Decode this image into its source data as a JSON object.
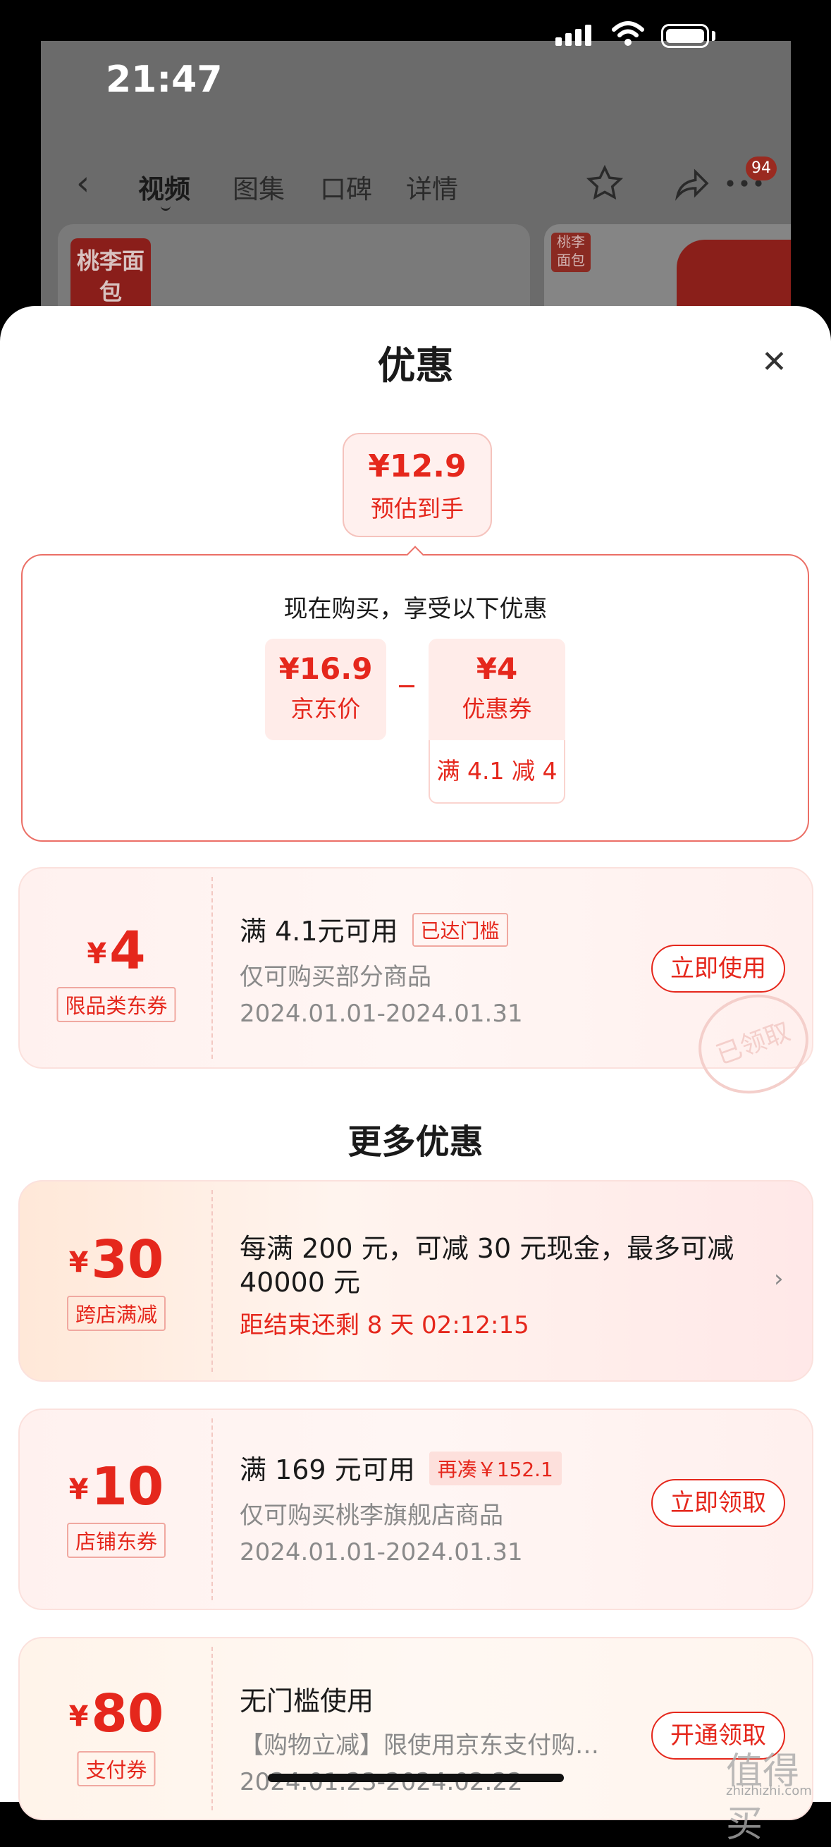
{
  "status_bar": {
    "time": "21:47"
  },
  "nav": {
    "tabs": [
      "视频",
      "图集",
      "口碑",
      "详情"
    ],
    "cart_badge": "94"
  },
  "background": {
    "logo_text": "桃李面包",
    "logo2_text": "桃李面包"
  },
  "sheet": {
    "title": "优惠",
    "estimate": {
      "price": "¥12.9",
      "label": "预估到手"
    },
    "breakdown_title": "现在购买，享受以下优惠",
    "jd_price": {
      "price": "¥16.9",
      "label": "京东价"
    },
    "coupon_price": {
      "price": "¥4",
      "label": "优惠券",
      "condition": "满 4.1 减 4"
    },
    "main_coupon": {
      "amount": "4",
      "currency": "¥",
      "tag": "限品类东券",
      "title": "满 4.1元可用",
      "pill": "已达门槛",
      "desc": "仅可购买部分商品",
      "date": "2024.01.01-2024.01.31",
      "button": "立即使用",
      "stamp": "已领取"
    },
    "more_title": "更多优惠",
    "offers": [
      {
        "amount": "30",
        "currency": "¥",
        "tag": "跨店满减",
        "title_line1": "每满 200 元，可减 30 元现金，最多可减",
        "title_line2": "40000 元",
        "countdown": "距结束还剩 8 天 02:12:15"
      },
      {
        "amount": "10",
        "currency": "¥",
        "tag": "店铺东券",
        "title": "满 169 元可用",
        "pill": "再凑￥152.1",
        "desc": "仅可购买桃李旗舰店商品",
        "date": "2024.01.01-2024.01.31",
        "button": "立即领取"
      },
      {
        "amount": "80",
        "currency": "¥",
        "tag": "支付券",
        "title": "无门槛使用",
        "desc": "【购物立减】限使用京东支付购…",
        "date": "2024.01.23-2024.02.22",
        "button": "开通领取"
      }
    ]
  },
  "watermark": {
    "main": "值得买",
    "sub": "zhizhizhi.com"
  }
}
